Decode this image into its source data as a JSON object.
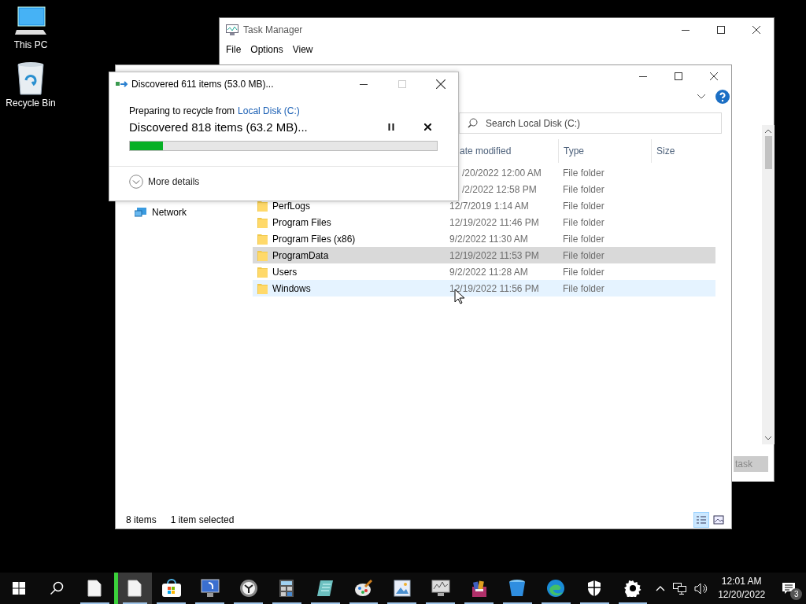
{
  "desktop_icons": [
    {
      "label": "This PC",
      "kind": "computer"
    },
    {
      "label": "Recycle Bin",
      "kind": "recycle-bin"
    }
  ],
  "task_manager": {
    "title": "Task Manager",
    "menu": [
      "File",
      "Options",
      "View"
    ],
    "end_task_button": "task"
  },
  "explorer": {
    "search": {
      "placeholder": "Search Local Disk (C:)"
    },
    "columns": [
      "ate modified",
      "Type",
      "Size"
    ],
    "navigation": [
      {
        "label": "Network"
      }
    ],
    "rows": [
      {
        "modified": "/20/2022 12:00 AM",
        "type": "File folder",
        "selected": false,
        "hovered": false
      },
      {
        "modified": "/2/2022 12:58 PM",
        "type": "File folder",
        "selected": false,
        "hovered": false
      },
      {
        "name": "PerfLogs",
        "modified": "12/7/2019 1:14 AM",
        "type": "File folder",
        "selected": false,
        "hovered": false
      },
      {
        "name": "Program Files",
        "modified": "12/19/2022 11:46 PM",
        "type": "File folder",
        "selected": false,
        "hovered": false
      },
      {
        "name": "Program Files (x86)",
        "modified": "9/2/2022 11:30 AM",
        "type": "File folder",
        "selected": false,
        "hovered": false
      },
      {
        "name": "ProgramData",
        "modified": "12/19/2022 11:53 PM",
        "type": "File folder",
        "selected": true,
        "hovered": false
      },
      {
        "name": "Users",
        "modified": "9/2/2022 11:28 AM",
        "type": "File folder",
        "selected": false,
        "hovered": false
      },
      {
        "name": "Windows",
        "modified": "12/19/2022 11:56 PM",
        "type": "File folder",
        "selected": false,
        "hovered": true
      }
    ],
    "status": {
      "item_count": "8 items",
      "selection": "1 item selected"
    },
    "view_modes": [
      {
        "kind": "details",
        "selected": true
      },
      {
        "kind": "large-icons",
        "selected": false
      }
    ]
  },
  "dialog": {
    "title": "Discovered 611 items (53.0 MB)...",
    "maximize_disabled": true,
    "source_prefix": "Preparing to recycle from",
    "source_link": "Local Disk (C:)",
    "status": "Discovered 818 items (63.2 MB)...",
    "level": 0.107,
    "details_button": "More details"
  },
  "taskbar": {
    "apps": [
      {
        "kind": "document",
        "running": true,
        "selected": false
      },
      {
        "kind": "document",
        "running": true,
        "selected": true
      },
      {
        "kind": "store",
        "running": true,
        "selected": false
      },
      {
        "kind": "remote",
        "running": true,
        "selected": false
      },
      {
        "kind": "clock",
        "running": true,
        "selected": false
      },
      {
        "kind": "calculator",
        "running": true,
        "selected": false
      },
      {
        "kind": "notepad",
        "running": true,
        "selected": false
      },
      {
        "kind": "paint",
        "running": true,
        "selected": false
      },
      {
        "kind": "image",
        "running": true,
        "selected": false
      },
      {
        "kind": "perfmon",
        "running": true,
        "selected": false
      },
      {
        "kind": "archive",
        "running": true,
        "selected": false
      },
      {
        "kind": "bucket",
        "running": true,
        "selected": false
      },
      {
        "kind": "browser",
        "running": true,
        "selected": false
      },
      {
        "kind": "shield",
        "running": true,
        "selected": false
      },
      {
        "kind": "settings",
        "running": true,
        "selected": false
      }
    ],
    "tray": {
      "time": "12:01 AM",
      "date": "12/20/2022",
      "notification_count": "3"
    }
  }
}
